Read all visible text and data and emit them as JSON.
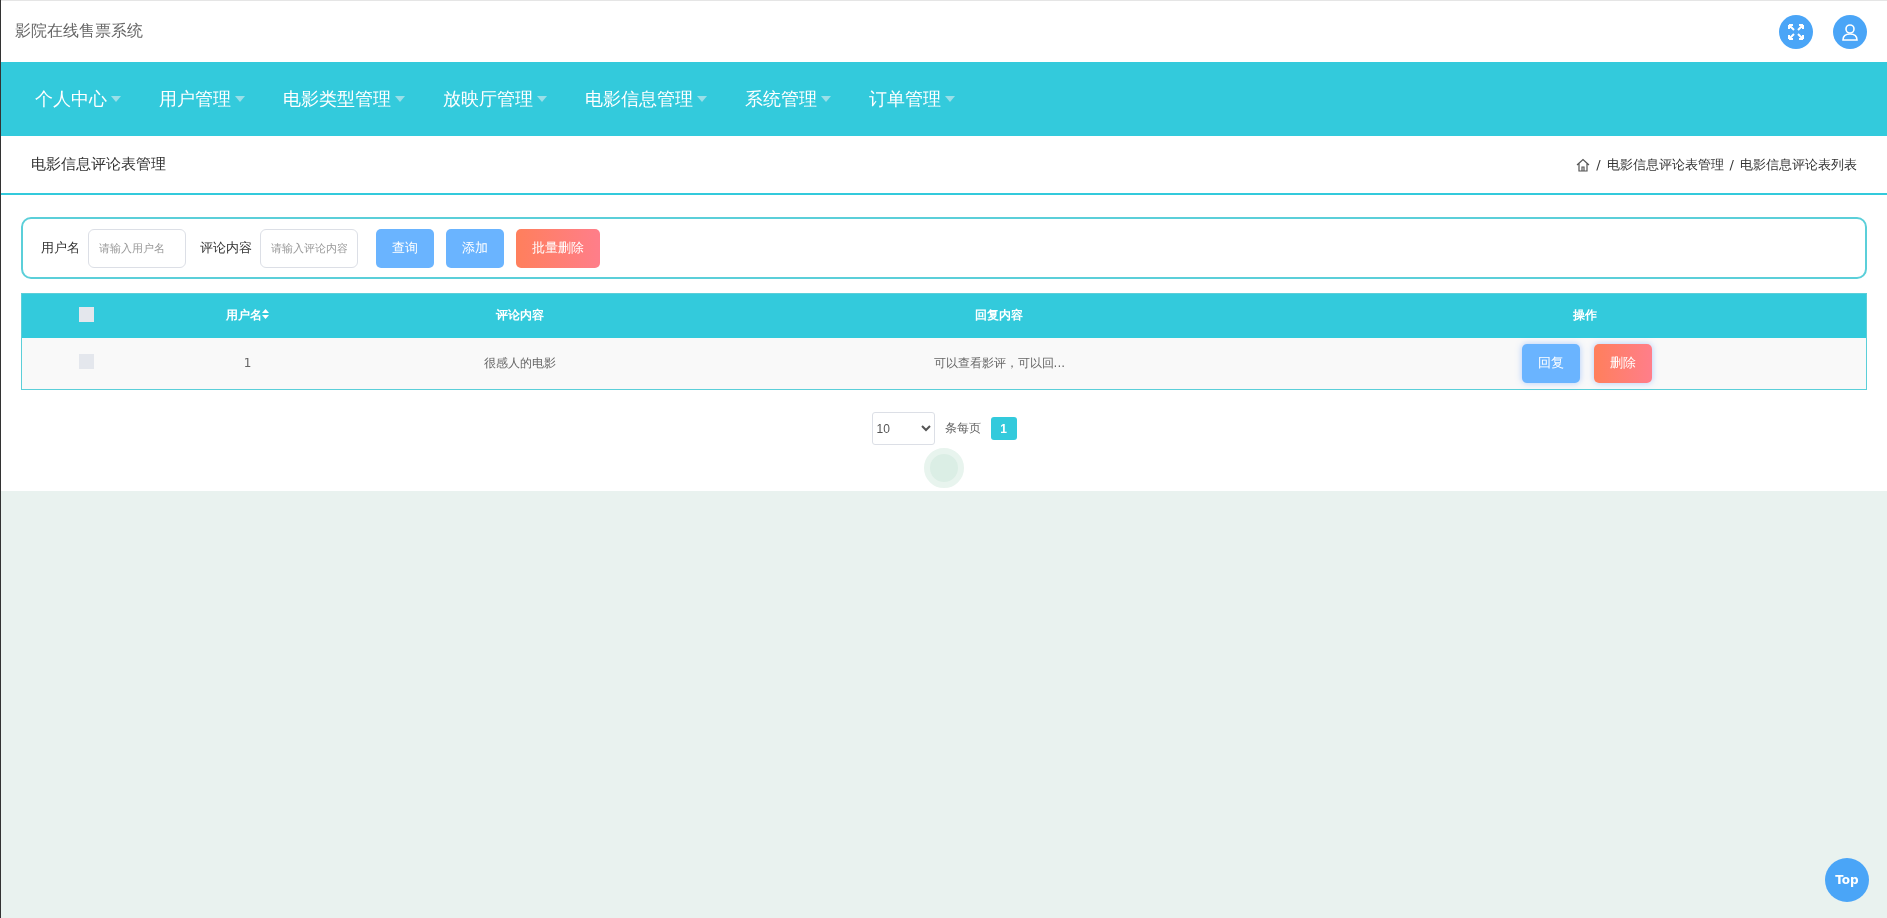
{
  "header": {
    "title": "影院在线售票系统"
  },
  "nav": [
    {
      "label": "个人中心"
    },
    {
      "label": "用户管理"
    },
    {
      "label": "电影类型管理"
    },
    {
      "label": "放映厅管理"
    },
    {
      "label": "电影信息管理"
    },
    {
      "label": "系统管理"
    },
    {
      "label": "订单管理"
    }
  ],
  "page_title": "电影信息评论表管理",
  "breadcrumb": [
    "电影信息评论表管理",
    "电影信息评论表列表"
  ],
  "breadcrumb_separator": "/",
  "search": {
    "fields": [
      {
        "label": "用户名",
        "placeholder": "请输入用户名"
      },
      {
        "label": "评论内容",
        "placeholder": "请输入评论内容"
      }
    ],
    "buttons": [
      {
        "label": "查询",
        "kind": "primary"
      },
      {
        "label": "添加",
        "kind": "primary"
      },
      {
        "label": "批量删除",
        "kind": "danger"
      }
    ]
  },
  "table": {
    "select_all_checked": false,
    "columns": [
      "用户名",
      "评论内容",
      "回复内容",
      "操作"
    ],
    "rows": [
      {
        "checked": false,
        "cells": [
          "1",
          "很感人的电影",
          "可以查看影评，可以回..."
        ],
        "actions": [
          {
            "label": "回复",
            "kind": "primary"
          },
          {
            "label": "删除",
            "kind": "danger"
          }
        ]
      }
    ]
  },
  "pagination": {
    "page_size": "10",
    "per_page_label": "条每页",
    "pages": [
      {
        "label": "1",
        "selected": true
      }
    ]
  },
  "back_to_top": "Top"
}
